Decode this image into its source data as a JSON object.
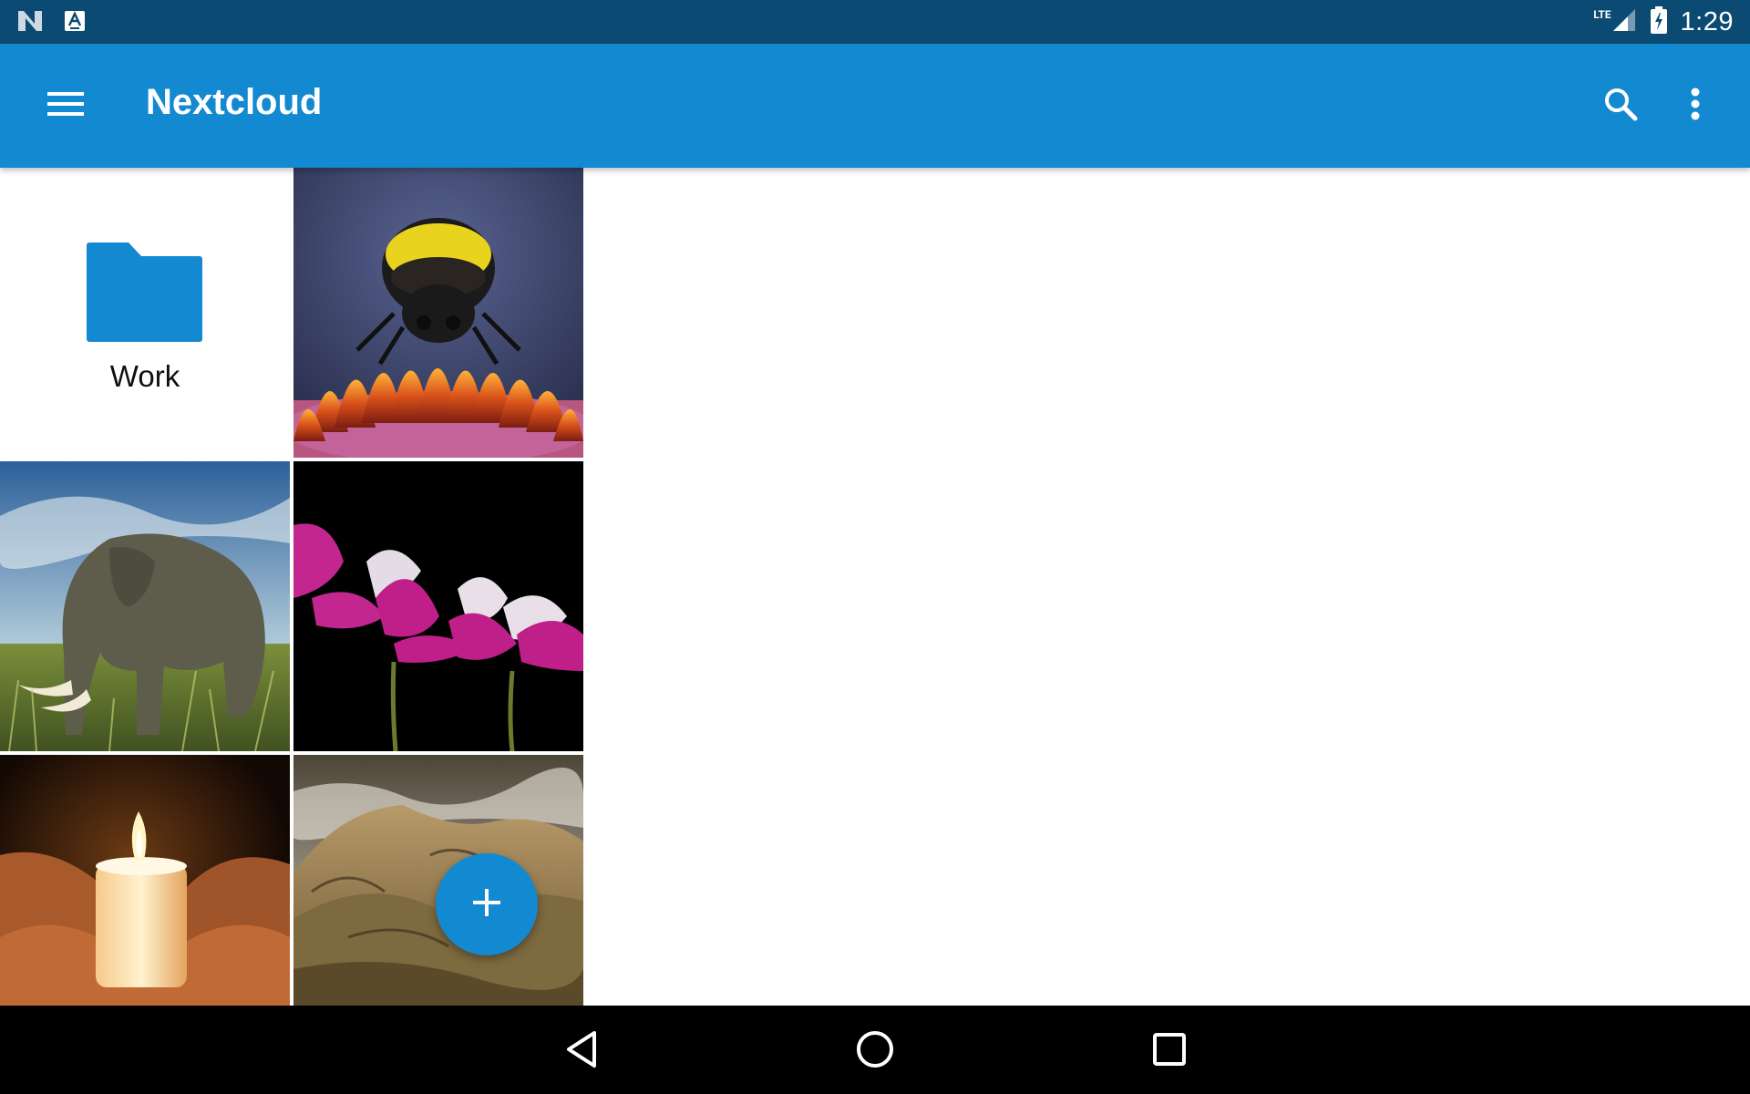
{
  "status_bar": {
    "time": "1:29",
    "network_label": "LTE",
    "icons": [
      "nextcloud-notification-icon",
      "keyboard-notification-icon",
      "signal-icon",
      "battery-charging-icon"
    ]
  },
  "app_bar": {
    "title": "Nextcloud",
    "icons": [
      "menu-icon",
      "search-icon",
      "more-vert-icon"
    ]
  },
  "files": [
    {
      "type": "folder",
      "name": "Work",
      "icon": "folder-icon",
      "color": "#1289d0"
    },
    {
      "type": "image",
      "subject": "bumblebee-on-flower"
    },
    {
      "type": "image",
      "subject": "elephant-in-grass"
    },
    {
      "type": "image",
      "subject": "pink-cosmos-flowers"
    },
    {
      "type": "image",
      "subject": "candle-in-hands"
    },
    {
      "type": "image",
      "subject": "mountain-hills"
    }
  ],
  "fab": {
    "icon": "plus-icon"
  },
  "nav_bar": {
    "icons": [
      "back-icon",
      "home-icon",
      "recents-icon"
    ]
  },
  "colors": {
    "status_bar": "#0b4a72",
    "app_bar": "#1289d0",
    "accent": "#1289d0",
    "nav_bar": "#000000"
  }
}
